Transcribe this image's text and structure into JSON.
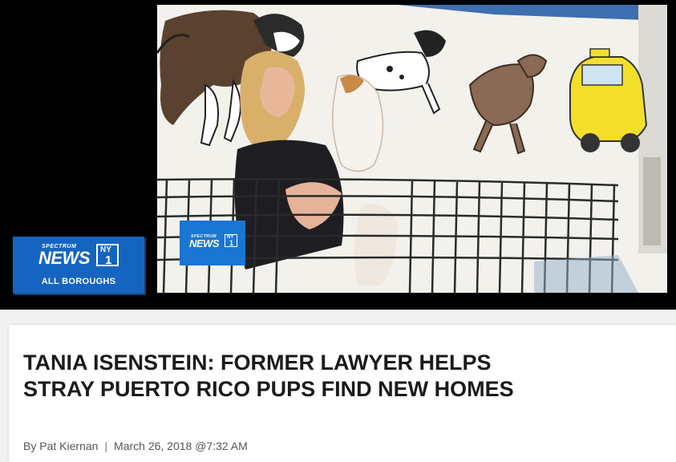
{
  "player": {
    "channel_card": {
      "brand_small": "SPECTRUM",
      "brand_main": "NEWS",
      "brand_region": "NY",
      "brand_number": "1",
      "region_label": "ALL BOROUGHS"
    },
    "video_bug": {
      "brand_small": "SPECTRUM",
      "brand_main": "NEWS",
      "brand_region": "NY",
      "brand_number": "1"
    }
  },
  "article": {
    "headline": "TANIA ISENSTEIN: FORMER LAWYER HELPS STRAY PUERTO RICO PUPS FIND NEW HOMES",
    "byline_author": "By Pat Kiernan",
    "byline_separator": "|",
    "byline_date": "March 26, 2018 @7:32 AM"
  },
  "colors": {
    "brand_blue": "#1565c0",
    "player_bg": "#000000",
    "headline_text": "#1b1b1b"
  }
}
